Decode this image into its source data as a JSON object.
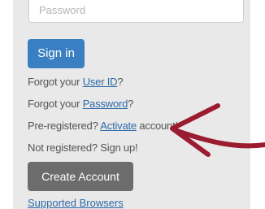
{
  "login": {
    "password_placeholder": "Password",
    "sign_in_label": "Sign in",
    "forgot_user_prefix": "Forgot your ",
    "forgot_user_link": "User ID",
    "forgot_user_suffix": "?",
    "forgot_password_prefix": "Forgot your ",
    "forgot_password_link": "Password",
    "forgot_password_suffix": "?",
    "preregistered_prefix": "Pre-registered? ",
    "activate_link": "Activate",
    "activate_suffix": " account!",
    "not_registered": "Not registered? Sign up!",
    "create_account_label": "Create Account",
    "supported_browsers": "Supported Browsers"
  },
  "annotation": {
    "arrow_color": "#9b1b30",
    "arrow_icon": "hand-drawn-arrow"
  },
  "colors": {
    "primary": "#3a7fc1",
    "secondary_button": "#6c6c6c",
    "link": "#2f6aa8",
    "panel_background": "#e9e9e9"
  }
}
